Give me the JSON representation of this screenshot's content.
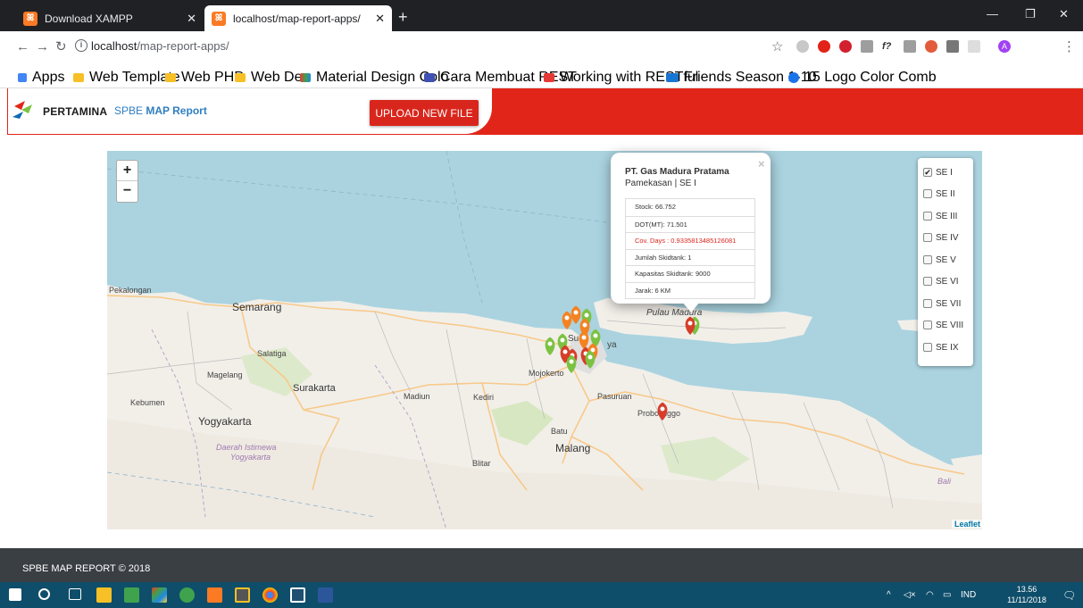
{
  "browser": {
    "tabs": [
      {
        "label": "Download XAMPP",
        "icon": "xampp-icon"
      },
      {
        "label": "localhost/map-report-apps/",
        "icon": "xampp-icon"
      }
    ],
    "new_tab": "+",
    "url_host": "localhost",
    "url_path": "/map-report-apps/",
    "bookmarks": [
      {
        "label": "Apps",
        "icon": "apps-grid-icon"
      },
      {
        "label": "Web Template",
        "icon": "folder-icon"
      },
      {
        "label": "Web PHP",
        "icon": "folder-icon"
      },
      {
        "label": "Web Dev",
        "icon": "folder-icon"
      },
      {
        "label": "Material Design Colo",
        "icon": "material-icon"
      },
      {
        "label": "Cara Membuat REST",
        "icon": "m-icon"
      },
      {
        "label": "Working with RESTful",
        "icon": "plus-red-icon"
      },
      {
        "label": "Friends Season 1-10",
        "icon": "pahe-icon"
      },
      {
        "label": "15 Logo Color Comb",
        "icon": "circle-icon"
      }
    ]
  },
  "header": {
    "brand": "PERTAMINA",
    "app_title_prefix": "SPBE",
    "app_title_main": "MAP Report",
    "upload_label": "UPLOAD NEW FILE"
  },
  "map": {
    "zoom_in": "+",
    "zoom_out": "−",
    "attribution": "Leaflet",
    "places": [
      "Pekalongan",
      "Semarang",
      "Salatiga",
      "Magelang",
      "Surakarta",
      "Kebumen",
      "Yogyakarta",
      "Daerah Istimewa",
      "Yogyakarta",
      "Madiun",
      "Kediri",
      "Batu",
      "Malang",
      "Blitar",
      "Mojokerto",
      "Pasuruan",
      "Probolinggo",
      "Pulau Madura",
      "Bali",
      "Su",
      "ya"
    ],
    "popup": {
      "name": "PT. Gas Madura Pratama",
      "subtitle": "Pamekasan | SE I",
      "close": "×",
      "rows": [
        {
          "text": "Stock: 66.752",
          "red": false
        },
        {
          "text": "DOT(MT): 71.501",
          "red": false
        },
        {
          "text": "Cov. Days : 0.9335813485126081",
          "red": true
        },
        {
          "text": "Jumlah Skidtank: 1",
          "red": false
        },
        {
          "text": "Kapasitas Skidtank: 9000",
          "red": false
        },
        {
          "text": "Jarak: 6 KM",
          "red": false
        }
      ]
    },
    "layers": [
      {
        "label": "SE I",
        "checked": true
      },
      {
        "label": "SE II",
        "checked": false
      },
      {
        "label": "SE III",
        "checked": false
      },
      {
        "label": "SE IV",
        "checked": false
      },
      {
        "label": "SE V",
        "checked": false
      },
      {
        "label": "SE VI",
        "checked": false
      },
      {
        "label": "SE VII",
        "checked": false
      },
      {
        "label": "SE VIII",
        "checked": false
      },
      {
        "label": "SE IX",
        "checked": false
      }
    ],
    "colors": {
      "water": "#aad3df",
      "land": "#f2efe9",
      "green": "#7cc242",
      "orange": "#f58220",
      "red": "#d63e2a"
    }
  },
  "footer": {
    "text": "SPBE MAP REPORT © 2018"
  },
  "taskbar": {
    "lang": "IND",
    "time": "13.56",
    "date": "11/11/2018"
  }
}
